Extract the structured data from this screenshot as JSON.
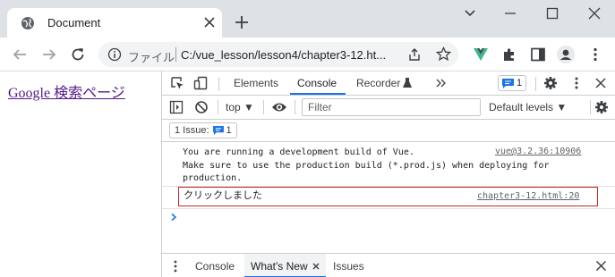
{
  "browser": {
    "tab": {
      "title": "Document",
      "icon": "globe-icon"
    },
    "address": {
      "scheme_label": "ファイル",
      "url": "C:/vue_lesson/lesson4/chapter3-12.ht..."
    }
  },
  "page": {
    "link_text": "Google 検索ページ"
  },
  "devtools": {
    "tabs": [
      "Elements",
      "Console",
      "Recorder"
    ],
    "active_tab": "Console",
    "issues_badge_count": "1",
    "context": "top",
    "filter_placeholder": "Filter",
    "levels": "Default levels",
    "issue_bar": {
      "label": "1 Issue:",
      "count": "1"
    },
    "console": {
      "vue_message": "You are running a development build of Vue.\nMake sure to use the production build (*.prod.js) when deploying for\nproduction.",
      "vue_source": "vue@3.2.36:10906",
      "log_message": "クリックしました",
      "log_source": "chapter3-12.html:20"
    },
    "drawer": {
      "tabs": [
        "Console",
        "What's New",
        "Issues"
      ],
      "active": "What's New"
    }
  },
  "colors": {
    "accent": "#1a73e8",
    "highlight_border": "#c62828",
    "vue_green": "#41b883"
  }
}
